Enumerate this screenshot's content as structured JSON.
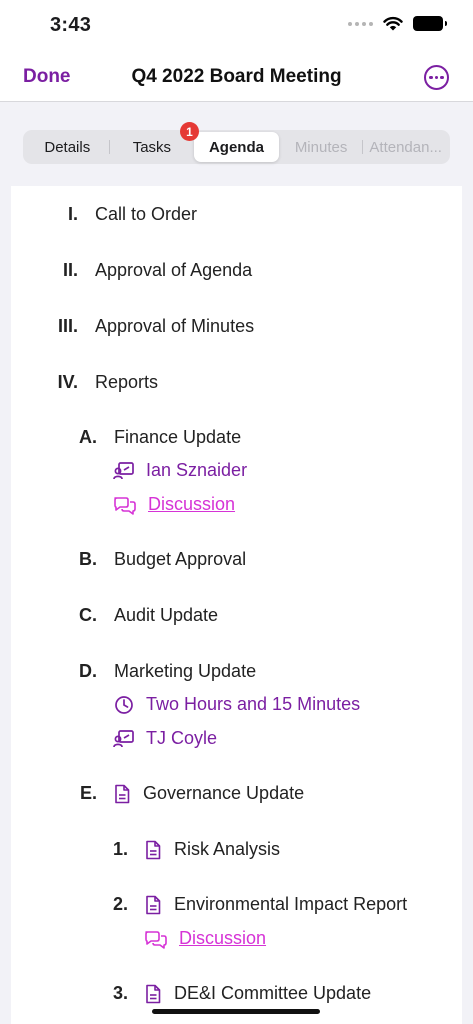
{
  "status": {
    "time": "3:43"
  },
  "nav": {
    "done": "Done",
    "title": "Q4 2022 Board Meeting"
  },
  "tabs": [
    {
      "label": "Details"
    },
    {
      "label": "Tasks",
      "badge": "1"
    },
    {
      "label": "Agenda",
      "active": true
    },
    {
      "label": "Minutes",
      "disabled": true
    },
    {
      "label": "Attendan...",
      "disabled": true
    }
  ],
  "agenda": {
    "i": {
      "num": "I.",
      "title": "Call to Order"
    },
    "ii": {
      "num": "II.",
      "title": "Approval of Agenda"
    },
    "iii": {
      "num": "III.",
      "title": "Approval of Minutes"
    },
    "iv": {
      "num": "IV.",
      "title": "Reports"
    },
    "a": {
      "num": "A.",
      "title": "Finance Update",
      "presenter": "Ian Sznaider",
      "discussion": "Discussion"
    },
    "b": {
      "num": "B.",
      "title": "Budget Approval"
    },
    "c": {
      "num": "C.",
      "title": "Audit Update"
    },
    "d": {
      "num": "D.",
      "title": "Marketing Update",
      "duration": "Two Hours and 15 Minutes",
      "presenter": "TJ Coyle"
    },
    "e": {
      "num": "E.",
      "title": "Governance Update"
    },
    "e1": {
      "num": "1.",
      "title": "Risk Analysis"
    },
    "e2": {
      "num": "2.",
      "title": "Environmental Impact Report",
      "discussion": "Discussion"
    },
    "e3": {
      "num": "3.",
      "title": "DE&I Committee Update"
    }
  },
  "colors": {
    "accent": "#7b1fa2",
    "link": "#d633d6",
    "badge": "#e53935"
  }
}
